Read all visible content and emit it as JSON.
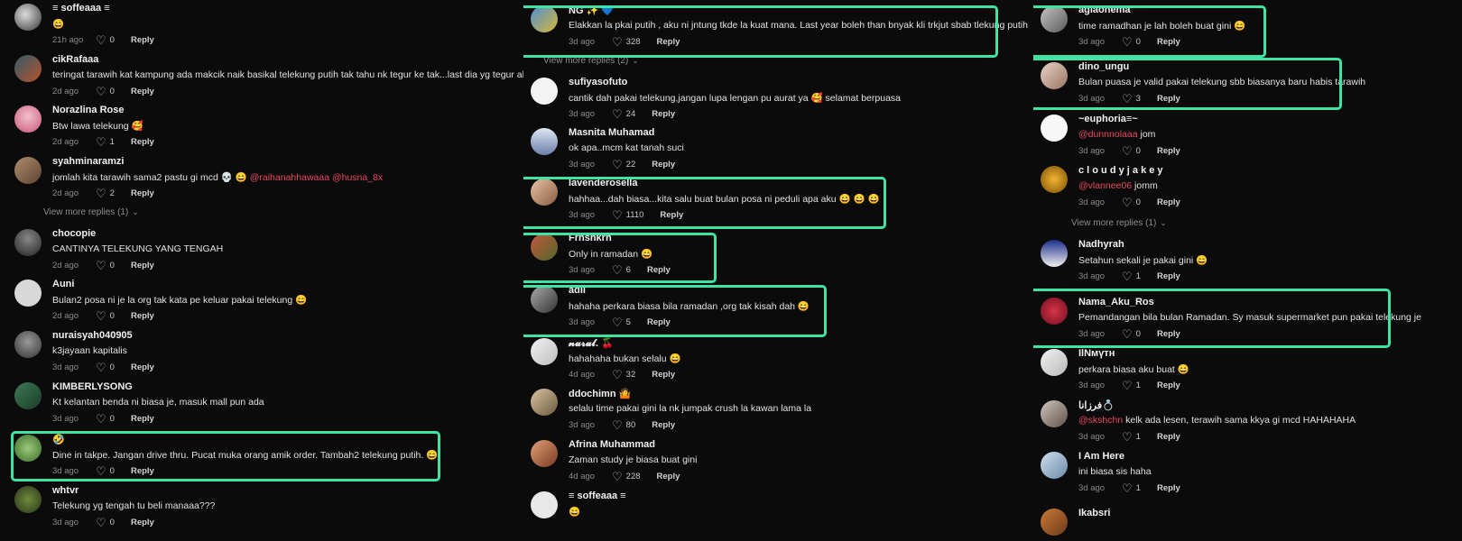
{
  "columns": [
    {
      "comments": [
        {
          "avatar": "a1",
          "username": "≡ soffeaaa ≡",
          "text": "😄",
          "age": "21h ago",
          "likes": "0",
          "reply": "Reply"
        },
        {
          "avatar": "a2",
          "username": "cikRafaaa",
          "text": "teringat tarawih kat kampung ada makcik naik basikal telekung putih tak tahu nk tegur ke tak...last dia yg tegur aku...",
          "age": "2d ago",
          "likes": "0",
          "reply": "Reply"
        },
        {
          "avatar": "a3",
          "username": "Norazlina Rose",
          "text": "Btw lawa telekung 🥰",
          "age": "2d ago",
          "likes": "1",
          "reply": "Reply"
        },
        {
          "avatar": "a4",
          "username": "syahminaramzi",
          "text": "jomlah kita tarawih sama2 pastu gi mcd 💀 😄 ",
          "mentions": "@raihanahhawaaa @husna_8x",
          "age": "2d ago",
          "likes": "2",
          "reply": "Reply"
        },
        {
          "avatar": "a5",
          "username": "chocopie",
          "text": "CANTINYA TELEKUNG YANG TENGAH",
          "age": "2d ago",
          "likes": "0",
          "reply": "Reply"
        },
        {
          "avatar": "a6",
          "username": "Auni",
          "text": "Bulan2 posa ni je la org tak kata pe keluar pakai telekung 😄",
          "age": "2d ago",
          "likes": "0",
          "reply": "Reply"
        },
        {
          "avatar": "a7",
          "username": "nuraisyah040905",
          "text": "k3jayaan kapitalis",
          "age": "3d ago",
          "likes": "0",
          "reply": "Reply"
        },
        {
          "avatar": "a8",
          "username": "KIMBERLYSONG",
          "text": "Kt kelantan benda ni biasa je, masuk mall pun ada",
          "age": "3d ago",
          "likes": "0",
          "reply": "Reply"
        },
        {
          "avatar": "a9",
          "username": "🤣",
          "text": "Dine in takpe. Jangan drive thru. Pucat muka orang amik order. Tambah2 telekung putih. 😄",
          "age": "3d ago",
          "likes": "0",
          "reply": "Reply"
        },
        {
          "avatar": "a10",
          "username": "whtvr",
          "text": "Telekung yg tengah tu beli manaaa???",
          "age": "3d ago",
          "likes": "0",
          "reply": "Reply"
        }
      ],
      "view_more": "View more replies (1)"
    },
    {
      "comments": [
        {
          "avatar": "b1",
          "username": "NG ✨ 💙",
          "text": "Elakkan la pkai putih , aku ni jntung tkde la kuat mana. Last year boleh than bnyak kli trkjut sbab tlekung putih",
          "age": "3d ago",
          "likes": "328",
          "reply": "Reply"
        },
        {
          "avatar": "b2",
          "username": "sufiyasofuto",
          "text": "cantik dah pakai telekung,jangan lupa lengan pu aurat ya 🥰 selamat berpuasa",
          "age": "3d ago",
          "likes": "24",
          "reply": "Reply"
        },
        {
          "avatar": "b3",
          "username": "Masnita Muhamad",
          "text": "ok apa..mcm kat tanah suci",
          "age": "3d ago",
          "likes": "22",
          "reply": "Reply"
        },
        {
          "avatar": "b4",
          "username": "lavenderosella",
          "text": "hahhaa...dah biasa...kita salu buat bulan posa ni peduli apa aku 😄 😄 😄",
          "age": "3d ago",
          "likes": "1110",
          "reply": "Reply"
        },
        {
          "avatar": "b5",
          "username": "Frhshkrh",
          "text": "Only in ramadan 😄",
          "age": "3d ago",
          "likes": "6",
          "reply": "Reply"
        },
        {
          "avatar": "b6",
          "username": "adli",
          "text": "hahaha perkara biasa bila ramadan ,org tak kisah dah 😄",
          "age": "3d ago",
          "likes": "5",
          "reply": "Reply"
        },
        {
          "avatar": "b7",
          "username": "𝓷𝓾𝓻𝓾𝓵. 🍒",
          "text": "hahahaha bukan selalu 😄",
          "age": "4d ago",
          "likes": "32",
          "reply": "Reply"
        },
        {
          "avatar": "b8",
          "username": "ddochimn 🤷",
          "text": "selalu time pakai gini la nk jumpak crush la kawan lama la",
          "age": "3d ago",
          "likes": "80",
          "reply": "Reply"
        },
        {
          "avatar": "b9",
          "username": "Afrina Muhammad",
          "text": "Zaman study je biasa buat gini",
          "age": "4d ago",
          "likes": "228",
          "reply": "Reply"
        },
        {
          "avatar": "b10",
          "username": "≡ soffeaaa ≡",
          "text": "😄",
          "age": "",
          "likes": "",
          "reply": ""
        }
      ],
      "view_more": "View more replies (2)"
    },
    {
      "comments": [
        {
          "avatar": "d1",
          "username": "aglaonema",
          "text": "time ramadhan je lah boleh buat gini 😄",
          "age": "3d ago",
          "likes": "0",
          "reply": "Reply"
        },
        {
          "avatar": "d2",
          "username": "dino_ungu",
          "text": "Bulan puasa je valid pakai telekung sbb biasanya baru habis tarawih",
          "age": "3d ago",
          "likes": "3",
          "reply": "Reply"
        },
        {
          "avatar": "d3",
          "username": "~euphoria≡~",
          "text": " jom",
          "mentions": "@dunnnolaaa",
          "age": "3d ago",
          "likes": "0",
          "reply": "Reply"
        },
        {
          "avatar": "d4",
          "username": "c l o u d y j a k e y",
          "text": " jomm",
          "mentions": "@vlannee06",
          "age": "3d ago",
          "likes": "0",
          "reply": "Reply"
        },
        {
          "avatar": "d5",
          "username": "Nadhyrah",
          "text": "Setahun sekali je pakai gini 😄",
          "age": "3d ago",
          "likes": "1",
          "reply": "Reply"
        },
        {
          "avatar": "d6",
          "username": "Nama_Aku_Ros",
          "text": "Pemandangan bila bulan Ramadan. Sy masuk supermarket pun pakai telekung je",
          "age": "3d ago",
          "likes": "0",
          "reply": "Reply"
        },
        {
          "avatar": "d7",
          "username": "IlNмүтн",
          "text": "perkara biasa aku buat 😄",
          "age": "3d ago",
          "likes": "1",
          "reply": "Reply"
        },
        {
          "avatar": "d8",
          "username": "فرزانا💍",
          "text": " kelk ada lesen, terawih sama kkya gi mcd HAHAHAHA",
          "mentions": "@skshchn",
          "age": "3d ago",
          "likes": "1",
          "reply": "Reply"
        },
        {
          "avatar": "d9",
          "username": "I Am Here",
          "text": "ini biasa sis haha",
          "age": "3d ago",
          "likes": "1",
          "reply": "Reply"
        },
        {
          "avatar": "d10",
          "username": "Ikabsri",
          "text": "",
          "age": "",
          "likes": "",
          "reply": ""
        }
      ],
      "view_more": "View more replies (1)"
    }
  ]
}
